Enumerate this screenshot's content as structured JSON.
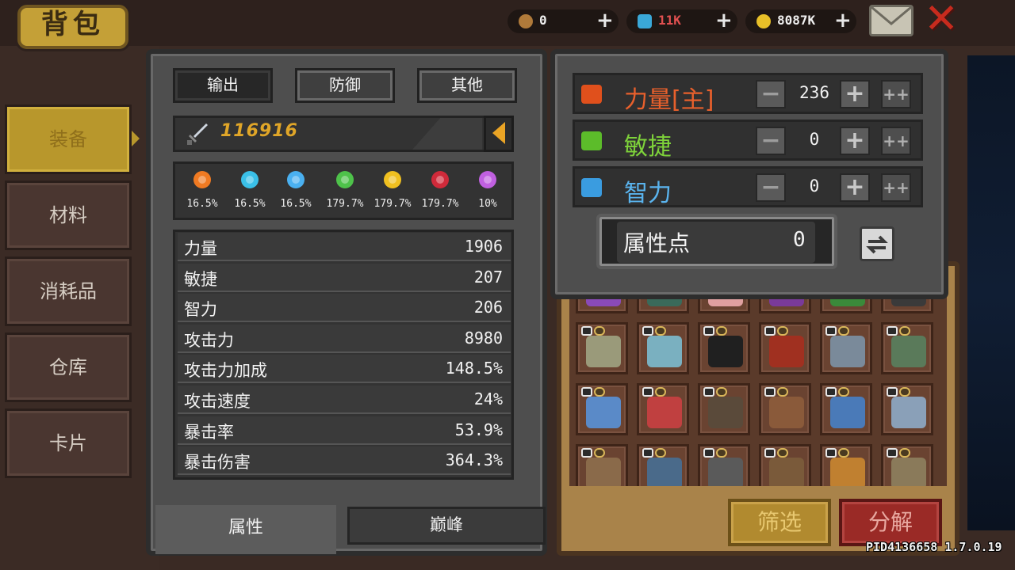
{
  "header": {
    "title": "背包",
    "currencies": [
      {
        "name": "keys",
        "value": "0",
        "color": "#b07a3a"
      },
      {
        "name": "gems",
        "value": "11K",
        "color": "#3aa8d8"
      },
      {
        "name": "gold",
        "value": "8087K",
        "color": "#e8c028"
      }
    ],
    "plus_symbol": "+"
  },
  "nav": {
    "items": [
      {
        "label": "装备",
        "active": true
      },
      {
        "label": "材料"
      },
      {
        "label": "消耗品"
      },
      {
        "label": "仓库"
      },
      {
        "label": "卡片"
      }
    ]
  },
  "stats": {
    "tabs": [
      "输出",
      "防御",
      "其他"
    ],
    "active_tab": "输出",
    "power": "116916",
    "elements": [
      {
        "icon": "fire-icon",
        "value": "16.5%",
        "color": "#f07a22"
      },
      {
        "icon": "ice-crystal-icon",
        "value": "16.5%",
        "color": "#3ac0e8"
      },
      {
        "icon": "lightning-icon",
        "value": "16.5%",
        "color": "#4ab0f0"
      },
      {
        "icon": "poison-skull-icon",
        "value": "179.7%",
        "color": "#4ec24a"
      },
      {
        "icon": "light-sun-icon",
        "value": "179.7%",
        "color": "#f0c020"
      },
      {
        "icon": "dark-crescent-icon",
        "value": "179.7%",
        "color": "#d02a3a"
      },
      {
        "icon": "arcane-star-icon",
        "value": "10%",
        "color": "#c060e0"
      }
    ],
    "attributes": [
      {
        "name": "力量",
        "value": "1906"
      },
      {
        "name": "敏捷",
        "value": "207"
      },
      {
        "name": "智力",
        "value": "206"
      },
      {
        "name": "攻击力",
        "value": "8980"
      },
      {
        "name": "攻击力加成",
        "value": "148.5%"
      },
      {
        "name": "攻击速度",
        "value": "24%"
      },
      {
        "name": "暴击率",
        "value": "53.9%"
      },
      {
        "name": "暴击伤害",
        "value": "364.3%"
      }
    ],
    "bottom_tabs": [
      "属性",
      "巅峰"
    ]
  },
  "allocation": {
    "rows": [
      {
        "name": "力量[主]",
        "value": "236",
        "color": "#e8602c",
        "icon": "strength-fist-icon",
        "icon_color": "#e0501c"
      },
      {
        "name": "敏捷",
        "value": "0",
        "color": "#7ed23a",
        "icon": "agility-boot-icon",
        "icon_color": "#5cbc2a"
      },
      {
        "name": "智力",
        "value": "0",
        "color": "#5ab4ee",
        "icon": "intellect-book-icon",
        "icon_color": "#3a9ce0"
      }
    ],
    "minus_symbol": "−",
    "plus_symbol": "+",
    "double_plus_symbol": "++",
    "points_label": "属性点",
    "points_value": "0"
  },
  "inventory": {
    "filter_label": "筛选",
    "decompose_label": "分解",
    "items": [
      "#8a4ab8",
      "#3a6a5a",
      "#e0a0a0",
      "#7a3a9a",
      "#3a8a3a",
      "#3a3a3a",
      "#9a9a7a",
      "#7ab0c0",
      "#202020",
      "#a03020",
      "#7a8a9a",
      "#5a7a5a",
      "#5a8ac8",
      "#c04040",
      "#5a4a3a",
      "#8a5a3a",
      "#4a7ab8",
      "#8aa0b8",
      "#8a6a4a",
      "#4a6a8a",
      "#5a5a5a",
      "#7a5a3a",
      "#c08030",
      "#8a7a5a"
    ]
  },
  "version": "PID4136658 1.7.0.19"
}
